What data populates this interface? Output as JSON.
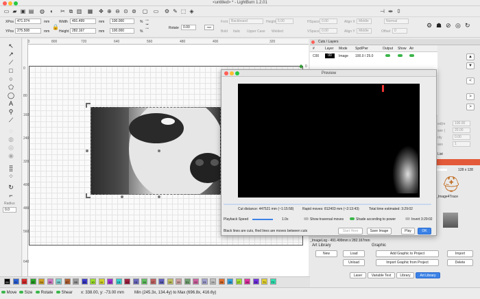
{
  "window": {
    "title": "<untitled> * - LightBurn 1.2.01"
  },
  "position": {
    "xpos_label": "XPos",
    "xpos_value": "471.074",
    "ypos_label": "YPos",
    "ypos_value": "275.508",
    "unit": "mm",
    "width_label": "Width",
    "width_value": "491.499",
    "height_label": "Height",
    "height_value": "282.167",
    "scale_w": "100.000",
    "scale_h": "100.000",
    "pct": "%",
    "rotate_label": "Rotate",
    "rotate_value": "0.00",
    "unit_rot": "mm"
  },
  "textbar": {
    "font_label": "Font",
    "font_value": "Backboard",
    "height_label": "Height",
    "height_value": "5.00",
    "hspace_label": "HSpace",
    "hspace_value": "0.00",
    "align_x_label": "Align X",
    "align_x_value": "Middle",
    "normal": "Normal",
    "bold_label": "Bold",
    "italic_label": "Italic",
    "upper_case_label": "Upper Case",
    "welded_label": "Welded",
    "vspace_label": "VSpace",
    "vspace_value": "0.00",
    "align_y_label": "Align Y",
    "align_y_value": "Middle",
    "offset_label": "Offset",
    "offset_value": "0"
  },
  "rulers": {
    "top": [
      "880",
      "800",
      "720",
      "640",
      "560",
      "480",
      "400",
      "320"
    ],
    "left": [
      "80",
      "160",
      "240",
      "320",
      "400",
      "480",
      "560",
      "640"
    ],
    "zero": "0",
    "origin": "0"
  },
  "palette": [
    "00",
    "01",
    "02",
    "03",
    "04",
    "05",
    "06",
    "07",
    "08",
    "09",
    "10",
    "11",
    "12",
    "13",
    "14",
    "15",
    "16",
    "17",
    "18",
    "19",
    "20",
    "21",
    "22",
    "23",
    "24",
    "25",
    "26",
    "27",
    "28",
    "29",
    "T1",
    "T2"
  ],
  "palette_colors": [
    "#000000",
    "#2a5fd6",
    "#d82a2a",
    "#28a528",
    "#d2a020",
    "#d27ac6",
    "#7ad2d2",
    "#b06030",
    "#9a9a9a",
    "#3a3acc",
    "#9adf2a",
    "#d2d22a",
    "#a030d0",
    "#30d0d0",
    "#a02040",
    "#6a6ac0",
    "#60c060",
    "#c06060",
    "#6060c0",
    "#c0c060",
    "#d0a0a0",
    "#70a070",
    "#d060a0",
    "#a0a0d0",
    "#c0c0c0",
    "#e07030",
    "#30a0e0",
    "#a0e030",
    "#e030a0",
    "#7030e0",
    "#e0d030",
    "#30e0b0"
  ],
  "status": {
    "move": "Move",
    "size": "Size",
    "rotate": "Rotate",
    "shear": "Shear",
    "coords": "x: 338.00, y: -73.00 mm",
    "range": "Min (245.3x, 134.4y) to Max (696.8x, 416.6y)"
  },
  "cuts": {
    "title": "Cuts / Layers",
    "headers": [
      "#",
      "Layer",
      "Mode",
      "Spd/Pwr",
      "Output",
      "Show",
      "Air"
    ],
    "row": {
      "num": "C00",
      "layer": "00",
      "mode": "Image",
      "spdpwr": "100.0 / 25.0"
    }
  },
  "right_values": [
    "100.00",
    "20.00",
    "0.00",
    "1"
  ],
  "right_values_labels": [
    "ed(m",
    "wer (",
    "rity",
    "ass",
    "List"
  ],
  "image_size": "128 x 128",
  "trace_label": "_Image4Trace",
  "imagelog": "_ImageLog - 491.499mm x 282.167mm",
  "art_library": {
    "title": "Art Library",
    "graphic_label": "Graphic",
    "new": "New",
    "load": "Load",
    "unload": "Unload",
    "add_graphic": "Add Graphic to Project",
    "import_graphic": "Import Graphic from Project",
    "import": "Import",
    "delete": "Delete",
    "size_label": "ctid."
  },
  "bottom_tabs": [
    "Laser",
    "Variable Text",
    "Library",
    "Art Library"
  ],
  "preview": {
    "title": "Preview",
    "cut_distance": "Cut distance: 447521 mm (~1:15:58)",
    "rapid_moves": "Rapid moves: 812403 mm (~2:13:43)",
    "total_time": "Total time estimated: 3:29:02",
    "playback_label": "Playback Speed",
    "speed_value": "1.0x",
    "show_traversal": "Show traversal moves",
    "shade_power": "Shade according to power",
    "invert": "Invert 3:29:02",
    "note": "Black lines are cuts, Red lines are moves between cuts",
    "start_here": "Start Here",
    "save_image": "Save Image",
    "play": "Play",
    "ok": "OK",
    "progress": 0.0
  },
  "lefttools": {
    "radius_label": "Radius",
    "radius_value": "0.0"
  }
}
